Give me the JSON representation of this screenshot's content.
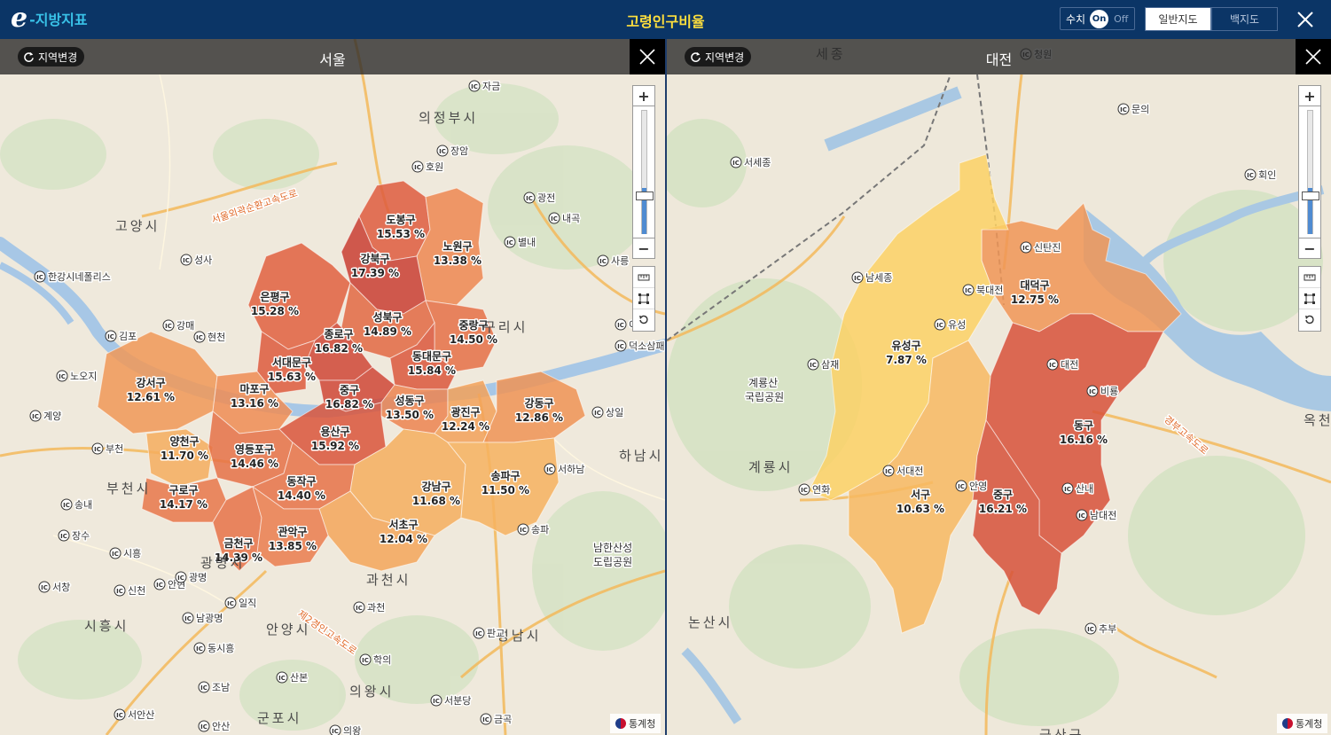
{
  "header": {
    "logo_e": "e",
    "logo_text": "-지방지표",
    "title": "고령인구비율",
    "toggle_label": "수치",
    "toggle_on": "On",
    "toggle_off": "Off",
    "map_general": "일반지도",
    "map_blank": "백지도"
  },
  "panels": [
    {
      "region_button": "지역변경",
      "region_name": "서울",
      "credit": "통계청",
      "zoom_level_fraction": 0.38,
      "districts": [
        {
          "name": "도봉구",
          "value": "15.53 %",
          "pct": 15.53
        },
        {
          "name": "노원구",
          "value": "13.38 %",
          "pct": 13.38
        },
        {
          "name": "강북구",
          "value": "17.39 %",
          "pct": 17.39
        },
        {
          "name": "은평구",
          "value": "15.28 %",
          "pct": 15.28
        },
        {
          "name": "성북구",
          "value": "14.89 %",
          "pct": 14.89
        },
        {
          "name": "종로구",
          "value": "16.82 %",
          "pct": 16.82
        },
        {
          "name": "중랑구",
          "value": "14.50 %",
          "pct": 14.5
        },
        {
          "name": "서대문구",
          "value": "15.63 %",
          "pct": 15.63
        },
        {
          "name": "동대문구",
          "value": "15.84 %",
          "pct": 15.84
        },
        {
          "name": "강서구",
          "value": "12.61 %",
          "pct": 12.61
        },
        {
          "name": "마포구",
          "value": "13.16 %",
          "pct": 13.16
        },
        {
          "name": "중구",
          "value": "16.82 %",
          "pct": 16.82
        },
        {
          "name": "성동구",
          "value": "13.50 %",
          "pct": 13.5
        },
        {
          "name": "광진구",
          "value": "12.24 %",
          "pct": 12.24
        },
        {
          "name": "강동구",
          "value": "12.86 %",
          "pct": 12.86
        },
        {
          "name": "양천구",
          "value": "11.70 %",
          "pct": 11.7
        },
        {
          "name": "영등포구",
          "value": "14.46 %",
          "pct": 14.46
        },
        {
          "name": "용산구",
          "value": "15.92 %",
          "pct": 15.92
        },
        {
          "name": "동작구",
          "value": "14.40 %",
          "pct": 14.4
        },
        {
          "name": "강남구",
          "value": "11.68 %",
          "pct": 11.68
        },
        {
          "name": "송파구",
          "value": "11.50 %",
          "pct": 11.5
        },
        {
          "name": "구로구",
          "value": "14.17 %",
          "pct": 14.17
        },
        {
          "name": "서초구",
          "value": "12.04 %",
          "pct": 12.04
        },
        {
          "name": "금천구",
          "value": "14.39 %",
          "pct": 14.39
        },
        {
          "name": "관악구",
          "value": "13.85 %",
          "pct": 13.85
        }
      ],
      "place_labels": [
        "의정부시",
        "고양시",
        "부천시",
        "광명시",
        "시흥시",
        "안양시",
        "과천시",
        "의왕시",
        "군포시",
        "성남시",
        "하남시",
        "구리시",
        "남한산성\n도립공원"
      ],
      "ic_labels": [
        "자금",
        "장암",
        "호원",
        "광전",
        "내곡",
        "별내",
        "사릉",
        "성사",
        "한강시네폴리스",
        "강매",
        "현천",
        "김포",
        "노오지",
        "계양",
        "부천",
        "송내",
        "장수",
        "시흥",
        "서창",
        "신천",
        "안현",
        "광명",
        "일직",
        "남광명",
        "동시흥",
        "학의",
        "과천",
        "조남",
        "산본",
        "서분당",
        "판교",
        "서하남",
        "상일",
        "덕소삼패",
        "이패",
        "서안산",
        "금곡",
        "의왕",
        "안산",
        "송파"
      ],
      "road_labels": [
        "서울외곽순환고속도로",
        "제2경인고속도로"
      ]
    },
    {
      "region_button": "지역변경",
      "region_name": "대전",
      "credit": "통계청",
      "zoom_level_fraction": 0.38,
      "districts": [
        {
          "name": "대덕구",
          "value": "12.75 %",
          "pct": 12.75
        },
        {
          "name": "유성구",
          "value": "7.87 %",
          "pct": 7.87
        },
        {
          "name": "동구",
          "value": "16.16 %",
          "pct": 16.16
        },
        {
          "name": "서구",
          "value": "10.63 %",
          "pct": 10.63
        },
        {
          "name": "중구",
          "value": "16.21 %",
          "pct": 16.21
        }
      ],
      "place_labels": [
        "세종",
        "계룡산\n국립공원",
        "계룡시",
        "논산시",
        "옥천",
        "금산군"
      ],
      "ic_labels": [
        "청원",
        "문의",
        "서세종",
        "회인",
        "신탄진",
        "남세종",
        "북대전",
        "유성",
        "삼재",
        "대전",
        "비룡",
        "서대전",
        "연화",
        "안영",
        "산내",
        "남대전",
        "추부"
      ],
      "road_labels": [
        "경부고속도로"
      ]
    }
  ]
}
